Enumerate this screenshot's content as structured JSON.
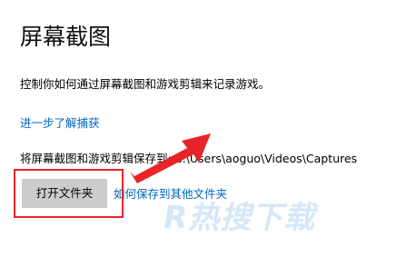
{
  "header": {
    "title": "屏幕截图"
  },
  "content": {
    "description": "控制你如何通过屏幕截图和游戏剪辑来记录游戏。",
    "learn_more_link": "进一步了解捕获",
    "save_location_label": "将屏幕截图和游戏剪辑保存到:",
    "save_location_path": "C:\\Users\\aoguo\\Videos\\Captures",
    "open_folder_button": "打开文件夹",
    "other_folder_link": "如何保存到其他文件夹"
  },
  "watermark": {
    "text": "R热搜下载"
  },
  "colors": {
    "link": "#0067c0",
    "annotation": "#e8232a",
    "button_bg": "#cccccc"
  }
}
